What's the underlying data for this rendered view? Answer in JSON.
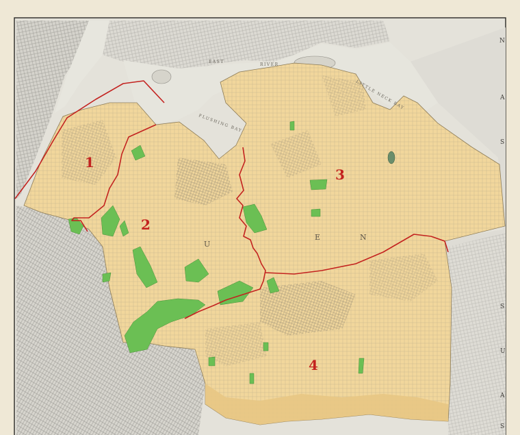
{
  "map": {
    "district_labels": [
      "1",
      "2",
      "3",
      "4"
    ],
    "water_labels": [
      "EAST",
      "RIVER",
      "FLUSHING BAY",
      "LITTLE NECK BAY"
    ],
    "county_letters": [
      "U",
      "E",
      "N"
    ],
    "margin_letters": [
      "S",
      "A",
      "U",
      "S",
      "S",
      "A",
      "N"
    ],
    "colors": {
      "queens_fill": "#f2d79c",
      "queens_fill_dark": "#e8c784",
      "park_green": "#6bbf54",
      "boundary_red": "#c3221f",
      "water": "#e3e2da",
      "paper": "#efe8d6",
      "outside_land": "#dcdad2",
      "street_ink": "#8b8272"
    }
  }
}
